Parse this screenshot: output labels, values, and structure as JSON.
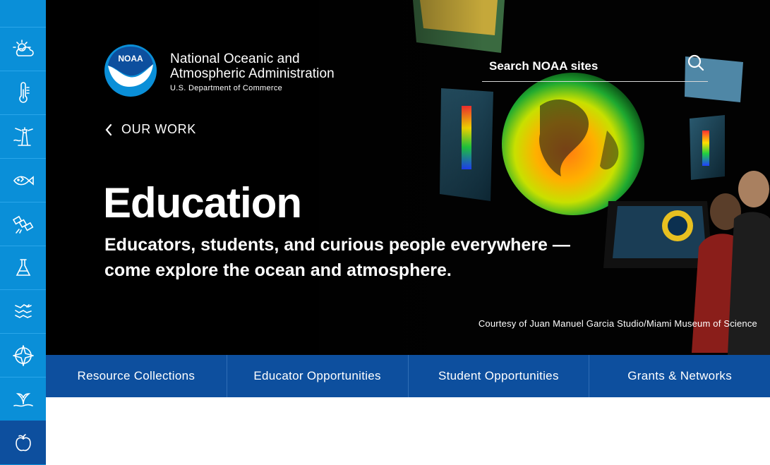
{
  "sidebar": {
    "items": [
      {
        "icon": "weather-icon"
      },
      {
        "icon": "thermometer-icon"
      },
      {
        "icon": "lighthouse-icon"
      },
      {
        "icon": "fish-icon"
      },
      {
        "icon": "satellite-icon"
      },
      {
        "icon": "flask-icon"
      },
      {
        "icon": "map-icon"
      },
      {
        "icon": "compass-icon"
      },
      {
        "icon": "whale-tail-icon"
      },
      {
        "icon": "apple-icon"
      }
    ],
    "active_index": 9
  },
  "header": {
    "logo_text": "NOAA",
    "org_name_line1": "National Oceanic and",
    "org_name_line2": "Atmospheric Administration",
    "org_sub": "U.S. Department of Commerce"
  },
  "search": {
    "placeholder": "Search NOAA sites"
  },
  "back_link": {
    "label": "OUR WORK"
  },
  "hero": {
    "title": "Education",
    "subtitle": "Educators, students, and curious people everywhere — come explore the ocean and atmosphere.",
    "credit": "Courtesy of Juan Manuel Garcia Studio/Miami Museum of Science"
  },
  "tabs": [
    {
      "label": "Resource Collections"
    },
    {
      "label": "Educator Opportunities"
    },
    {
      "label": "Student Opportunities"
    },
    {
      "label": "Grants & Networks"
    }
  ],
  "colors": {
    "rail": "#0a8fd8",
    "rail_active": "#0d4f9e",
    "tabs_bar": "#0d4f9e"
  }
}
